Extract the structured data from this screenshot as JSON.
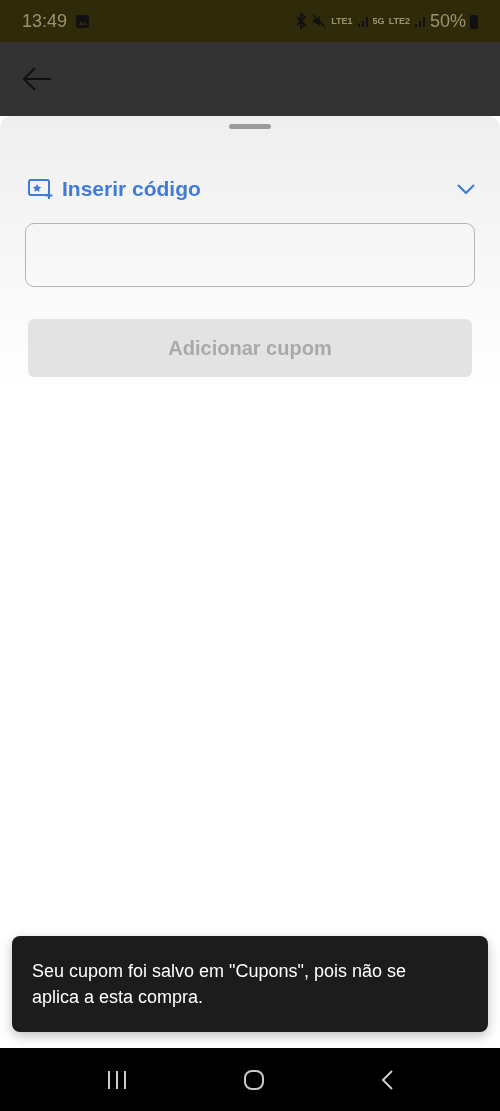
{
  "status_bar": {
    "time": "13:49",
    "network_labels": [
      "LTE1",
      "5G",
      "LTE2"
    ],
    "battery": "50%"
  },
  "sheet": {
    "section_title": "Inserir código",
    "button": {
      "label": "Adicionar cupom",
      "disabled": true
    }
  },
  "toast": {
    "message": "Seu cupom foi salvo em \"Cupons\", pois não se aplica a esta compra."
  }
}
